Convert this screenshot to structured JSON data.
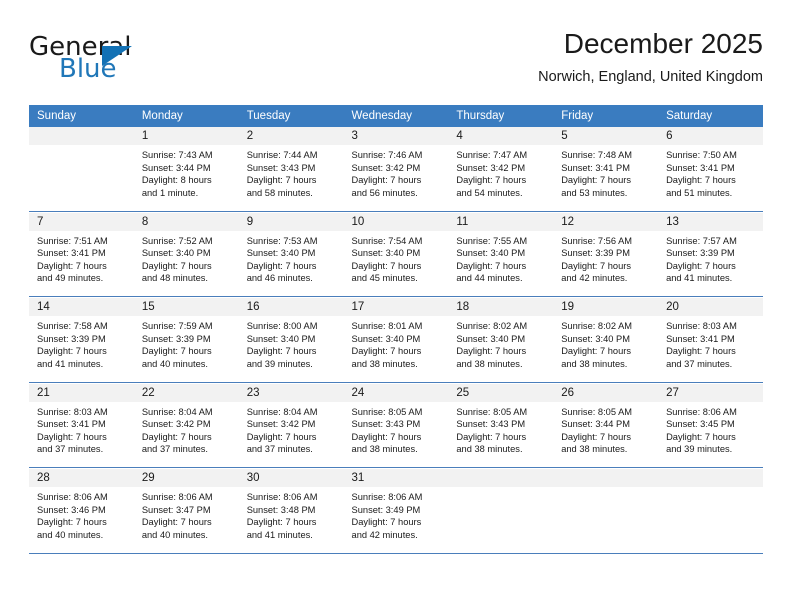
{
  "brand": {
    "name_top": "General",
    "name_bottom": "Blue",
    "accent_color": "#1271b5",
    "text_color": "#1a1a1a"
  },
  "header": {
    "title": "December 2025",
    "subtitle": "Norwich, England, United Kingdom"
  },
  "calendar": {
    "header_bg": "#3a7cc0",
    "daynum_bg": "#f2f2f2",
    "separator_color": "#4a7ebb",
    "weekdays": [
      "Sunday",
      "Monday",
      "Tuesday",
      "Wednesday",
      "Thursday",
      "Friday",
      "Saturday"
    ],
    "weeks": [
      {
        "days": [
          {
            "num": "",
            "lines": []
          },
          {
            "num": "1",
            "lines": [
              "Sunrise: 7:43 AM",
              "Sunset: 3:44 PM",
              "Daylight: 8 hours",
              "and 1 minute."
            ]
          },
          {
            "num": "2",
            "lines": [
              "Sunrise: 7:44 AM",
              "Sunset: 3:43 PM",
              "Daylight: 7 hours",
              "and 58 minutes."
            ]
          },
          {
            "num": "3",
            "lines": [
              "Sunrise: 7:46 AM",
              "Sunset: 3:42 PM",
              "Daylight: 7 hours",
              "and 56 minutes."
            ]
          },
          {
            "num": "4",
            "lines": [
              "Sunrise: 7:47 AM",
              "Sunset: 3:42 PM",
              "Daylight: 7 hours",
              "and 54 minutes."
            ]
          },
          {
            "num": "5",
            "lines": [
              "Sunrise: 7:48 AM",
              "Sunset: 3:41 PM",
              "Daylight: 7 hours",
              "and 53 minutes."
            ]
          },
          {
            "num": "6",
            "lines": [
              "Sunrise: 7:50 AM",
              "Sunset: 3:41 PM",
              "Daylight: 7 hours",
              "and 51 minutes."
            ]
          }
        ]
      },
      {
        "days": [
          {
            "num": "7",
            "lines": [
              "Sunrise: 7:51 AM",
              "Sunset: 3:41 PM",
              "Daylight: 7 hours",
              "and 49 minutes."
            ]
          },
          {
            "num": "8",
            "lines": [
              "Sunrise: 7:52 AM",
              "Sunset: 3:40 PM",
              "Daylight: 7 hours",
              "and 48 minutes."
            ]
          },
          {
            "num": "9",
            "lines": [
              "Sunrise: 7:53 AM",
              "Sunset: 3:40 PM",
              "Daylight: 7 hours",
              "and 46 minutes."
            ]
          },
          {
            "num": "10",
            "lines": [
              "Sunrise: 7:54 AM",
              "Sunset: 3:40 PM",
              "Daylight: 7 hours",
              "and 45 minutes."
            ]
          },
          {
            "num": "11",
            "lines": [
              "Sunrise: 7:55 AM",
              "Sunset: 3:40 PM",
              "Daylight: 7 hours",
              "and 44 minutes."
            ]
          },
          {
            "num": "12",
            "lines": [
              "Sunrise: 7:56 AM",
              "Sunset: 3:39 PM",
              "Daylight: 7 hours",
              "and 42 minutes."
            ]
          },
          {
            "num": "13",
            "lines": [
              "Sunrise: 7:57 AM",
              "Sunset: 3:39 PM",
              "Daylight: 7 hours",
              "and 41 minutes."
            ]
          }
        ]
      },
      {
        "days": [
          {
            "num": "14",
            "lines": [
              "Sunrise: 7:58 AM",
              "Sunset: 3:39 PM",
              "Daylight: 7 hours",
              "and 41 minutes."
            ]
          },
          {
            "num": "15",
            "lines": [
              "Sunrise: 7:59 AM",
              "Sunset: 3:39 PM",
              "Daylight: 7 hours",
              "and 40 minutes."
            ]
          },
          {
            "num": "16",
            "lines": [
              "Sunrise: 8:00 AM",
              "Sunset: 3:40 PM",
              "Daylight: 7 hours",
              "and 39 minutes."
            ]
          },
          {
            "num": "17",
            "lines": [
              "Sunrise: 8:01 AM",
              "Sunset: 3:40 PM",
              "Daylight: 7 hours",
              "and 38 minutes."
            ]
          },
          {
            "num": "18",
            "lines": [
              "Sunrise: 8:02 AM",
              "Sunset: 3:40 PM",
              "Daylight: 7 hours",
              "and 38 minutes."
            ]
          },
          {
            "num": "19",
            "lines": [
              "Sunrise: 8:02 AM",
              "Sunset: 3:40 PM",
              "Daylight: 7 hours",
              "and 38 minutes."
            ]
          },
          {
            "num": "20",
            "lines": [
              "Sunrise: 8:03 AM",
              "Sunset: 3:41 PM",
              "Daylight: 7 hours",
              "and 37 minutes."
            ]
          }
        ]
      },
      {
        "days": [
          {
            "num": "21",
            "lines": [
              "Sunrise: 8:03 AM",
              "Sunset: 3:41 PM",
              "Daylight: 7 hours",
              "and 37 minutes."
            ]
          },
          {
            "num": "22",
            "lines": [
              "Sunrise: 8:04 AM",
              "Sunset: 3:42 PM",
              "Daylight: 7 hours",
              "and 37 minutes."
            ]
          },
          {
            "num": "23",
            "lines": [
              "Sunrise: 8:04 AM",
              "Sunset: 3:42 PM",
              "Daylight: 7 hours",
              "and 37 minutes."
            ]
          },
          {
            "num": "24",
            "lines": [
              "Sunrise: 8:05 AM",
              "Sunset: 3:43 PM",
              "Daylight: 7 hours",
              "and 38 minutes."
            ]
          },
          {
            "num": "25",
            "lines": [
              "Sunrise: 8:05 AM",
              "Sunset: 3:43 PM",
              "Daylight: 7 hours",
              "and 38 minutes."
            ]
          },
          {
            "num": "26",
            "lines": [
              "Sunrise: 8:05 AM",
              "Sunset: 3:44 PM",
              "Daylight: 7 hours",
              "and 38 minutes."
            ]
          },
          {
            "num": "27",
            "lines": [
              "Sunrise: 8:06 AM",
              "Sunset: 3:45 PM",
              "Daylight: 7 hours",
              "and 39 minutes."
            ]
          }
        ]
      },
      {
        "days": [
          {
            "num": "28",
            "lines": [
              "Sunrise: 8:06 AM",
              "Sunset: 3:46 PM",
              "Daylight: 7 hours",
              "and 40 minutes."
            ]
          },
          {
            "num": "29",
            "lines": [
              "Sunrise: 8:06 AM",
              "Sunset: 3:47 PM",
              "Daylight: 7 hours",
              "and 40 minutes."
            ]
          },
          {
            "num": "30",
            "lines": [
              "Sunrise: 8:06 AM",
              "Sunset: 3:48 PM",
              "Daylight: 7 hours",
              "and 41 minutes."
            ]
          },
          {
            "num": "31",
            "lines": [
              "Sunrise: 8:06 AM",
              "Sunset: 3:49 PM",
              "Daylight: 7 hours",
              "and 42 minutes."
            ]
          },
          {
            "num": "",
            "lines": []
          },
          {
            "num": "",
            "lines": []
          },
          {
            "num": "",
            "lines": []
          }
        ]
      }
    ]
  }
}
